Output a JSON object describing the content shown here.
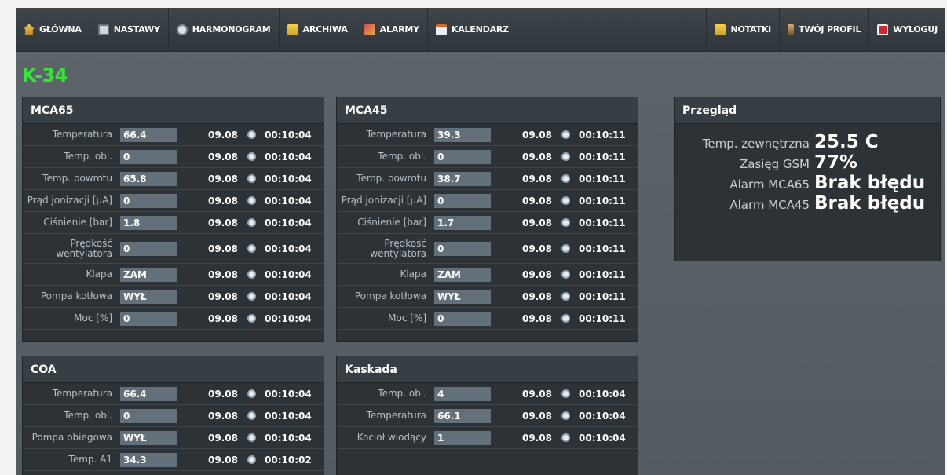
{
  "nav": {
    "left": [
      {
        "label": "GŁÓWNA",
        "icon": "home-icon"
      },
      {
        "label": "NASTAWY",
        "icon": "settings-grid-icon"
      },
      {
        "label": "HARMONOGRAM",
        "icon": "clock-icon"
      },
      {
        "label": "ARCHIWA",
        "icon": "folder-icon"
      },
      {
        "label": "ALARMY",
        "icon": "alarm-icon"
      },
      {
        "label": "KALENDARZ",
        "icon": "calendar-icon"
      }
    ],
    "right": [
      {
        "label": "NOTATKI",
        "icon": "notes-icon"
      },
      {
        "label": "TWÓJ PROFIL",
        "icon": "user-icon"
      },
      {
        "label": "WYLOGUJ",
        "icon": "logout-icon"
      }
    ]
  },
  "page_title": "K-34",
  "panels": {
    "mca65": {
      "title": "MCA65",
      "rows": [
        {
          "label": "Temperatura",
          "value": "66.4",
          "date": "09.08",
          "time": "00:10:04"
        },
        {
          "label": "Temp. obl.",
          "value": "0",
          "date": "09.08",
          "time": "00:10:04"
        },
        {
          "label": "Temp. powrotu",
          "value": "65.8",
          "date": "09.08",
          "time": "00:10:04"
        },
        {
          "label": "Prąd jonizacji [µA]",
          "value": "0",
          "date": "09.08",
          "time": "00:10:04"
        },
        {
          "label": "Ciśnienie [bar]",
          "value": "1.8",
          "date": "09.08",
          "time": "00:10:04"
        },
        {
          "label": "Prędkość wentylatora",
          "value": "0",
          "date": "09.08",
          "time": "00:10:04"
        },
        {
          "label": "Klapa",
          "value": "ZAM",
          "date": "09.08",
          "time": "00:10:04"
        },
        {
          "label": "Pompa kotłowa",
          "value": "WYŁ",
          "date": "09.08",
          "time": "00:10:04"
        },
        {
          "label": "Moc [%]",
          "value": "0",
          "date": "09.08",
          "time": "00:10:04"
        }
      ]
    },
    "mca45": {
      "title": "MCA45",
      "rows": [
        {
          "label": "Temperatura",
          "value": "39.3",
          "date": "09.08",
          "time": "00:10:11"
        },
        {
          "label": "Temp. obl.",
          "value": "0",
          "date": "09.08",
          "time": "00:10:11"
        },
        {
          "label": "Temp. powrotu",
          "value": "38.7",
          "date": "09.08",
          "time": "00:10:11"
        },
        {
          "label": "Prąd jonizacji [µA]",
          "value": "0",
          "date": "09.08",
          "time": "00:10:11"
        },
        {
          "label": "Ciśnienie [bar]",
          "value": "1.7",
          "date": "09.08",
          "time": "00:10:11"
        },
        {
          "label": "Prędkość wentylatora",
          "value": "0",
          "date": "09.08",
          "time": "00:10:11"
        },
        {
          "label": "Klapa",
          "value": "ZAM",
          "date": "09.08",
          "time": "00:10:11"
        },
        {
          "label": "Pompa kotłowa",
          "value": "WYŁ",
          "date": "09.08",
          "time": "00:10:11"
        },
        {
          "label": "Moc [%]",
          "value": "0",
          "date": "09.08",
          "time": "00:10:11"
        }
      ]
    },
    "coa": {
      "title": "COA",
      "rows": [
        {
          "label": "Temperatura",
          "value": "66.4",
          "date": "09.08",
          "time": "00:10:04"
        },
        {
          "label": "Temp. obl.",
          "value": "0",
          "date": "09.08",
          "time": "00:10:04"
        },
        {
          "label": "Pompa obiegowa",
          "value": "WYŁ",
          "date": "09.08",
          "time": "00:10:04"
        },
        {
          "label": "Temp. A1",
          "value": "34.3",
          "date": "09.08",
          "time": "00:10:02"
        }
      ]
    },
    "kaskada": {
      "title": "Kaskada",
      "rows": [
        {
          "label": "Temp. obl.",
          "value": "4",
          "date": "09.08",
          "time": "00:10:04"
        },
        {
          "label": "Temperatura",
          "value": "66.1",
          "date": "09.08",
          "time": "00:10:04"
        },
        {
          "label": "Kocioł wiodący",
          "value": "1",
          "date": "09.08",
          "time": "00:10:04"
        }
      ]
    },
    "overview": {
      "title": "Przegląd",
      "rows": [
        {
          "label": "Temp. zewnętrzna",
          "value": "25.5 C"
        },
        {
          "label": "Zasięg GSM",
          "value": "77%"
        },
        {
          "label": "Alarm MCA65",
          "value": "Brak błędu"
        },
        {
          "label": "Alarm MCA45",
          "value": "Brak błędu"
        }
      ]
    }
  }
}
